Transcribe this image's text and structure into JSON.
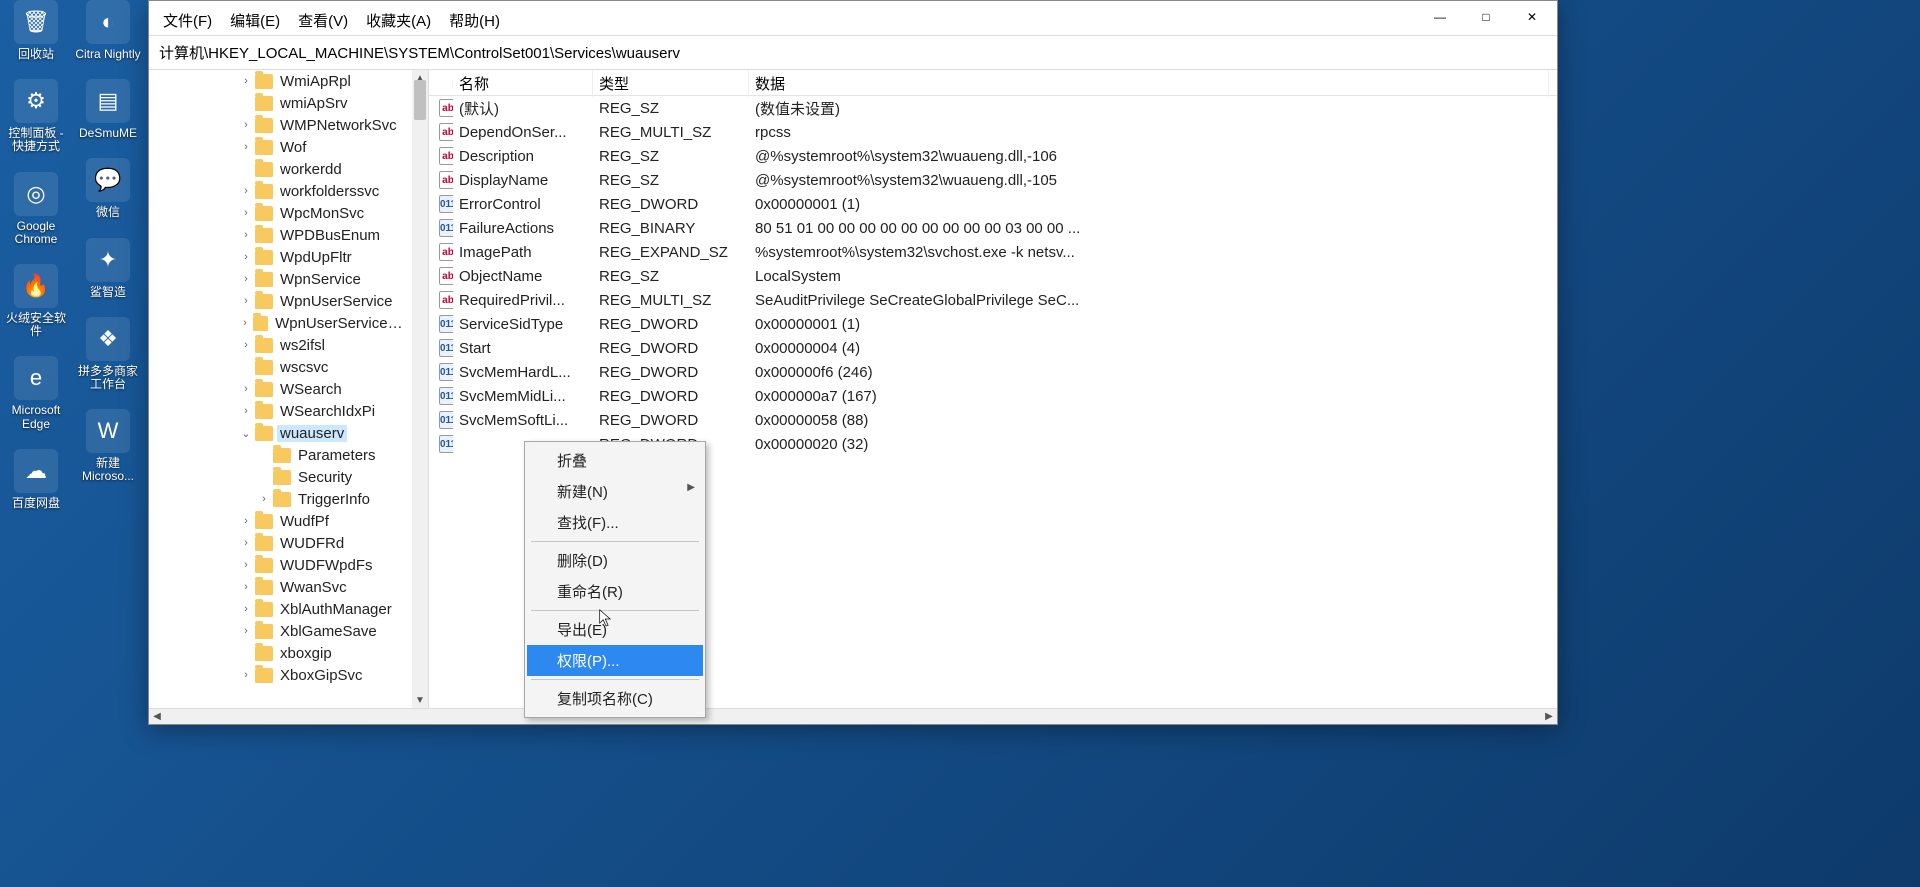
{
  "desktop_icons_col1": [
    {
      "label": "回收站",
      "glyph": "🗑"
    },
    {
      "label": "控制面板 - 快捷方式",
      "glyph": "⚙"
    },
    {
      "label": "Google Chrome",
      "glyph": "◎"
    },
    {
      "label": "火绒安全软件",
      "glyph": "🔥"
    },
    {
      "label": "Microsoft Edge",
      "glyph": "e"
    },
    {
      "label": "百度网盘",
      "glyph": "☁"
    }
  ],
  "desktop_icons_col2": [
    {
      "label": "Citra Nightly",
      "glyph": "◐"
    },
    {
      "label": "DeSmuME",
      "glyph": "▤"
    },
    {
      "label": "微信",
      "glyph": "💬"
    },
    {
      "label": "鲨智造",
      "glyph": "✦"
    },
    {
      "label": "拼多多商家工作台",
      "glyph": "❖"
    },
    {
      "label": "新建 Microso...",
      "glyph": "W"
    }
  ],
  "window": {
    "minimize": "—",
    "maximize": "□",
    "close": "✕",
    "menus": [
      "文件(F)",
      "编辑(E)",
      "查看(V)",
      "收藏夹(A)",
      "帮助(H)"
    ],
    "address": "计算机\\HKEY_LOCAL_MACHINE\\SYSTEM\\ControlSet001\\Services\\wuauserv"
  },
  "tree": [
    {
      "exp": ">",
      "label": "WmiApRpl",
      "ind": 1
    },
    {
      "exp": "",
      "label": "wmiApSrv",
      "ind": 1
    },
    {
      "exp": ">",
      "label": "WMPNetworkSvc",
      "ind": 1
    },
    {
      "exp": ">",
      "label": "Wof",
      "ind": 1
    },
    {
      "exp": "",
      "label": "workerdd",
      "ind": 1
    },
    {
      "exp": ">",
      "label": "workfolderssvc",
      "ind": 1
    },
    {
      "exp": ">",
      "label": "WpcMonSvc",
      "ind": 1
    },
    {
      "exp": ">",
      "label": "WPDBusEnum",
      "ind": 1
    },
    {
      "exp": ">",
      "label": "WpdUpFltr",
      "ind": 1
    },
    {
      "exp": ">",
      "label": "WpnService",
      "ind": 1
    },
    {
      "exp": ">",
      "label": "WpnUserService",
      "ind": 1
    },
    {
      "exp": ">",
      "label": "WpnUserService_xxxxx",
      "ind": 1
    },
    {
      "exp": ">",
      "label": "ws2ifsl",
      "ind": 1
    },
    {
      "exp": "",
      "label": "wscsvc",
      "ind": 1
    },
    {
      "exp": ">",
      "label": "WSearch",
      "ind": 1
    },
    {
      "exp": ">",
      "label": "WSearchIdxPi",
      "ind": 1
    },
    {
      "exp": "v",
      "label": "wuauserv",
      "ind": 1,
      "sel": true
    },
    {
      "exp": "",
      "label": "Parameters",
      "ind": 2
    },
    {
      "exp": "",
      "label": "Security",
      "ind": 2
    },
    {
      "exp": ">",
      "label": "TriggerInfo",
      "ind": 2
    },
    {
      "exp": ">",
      "label": "WudfPf",
      "ind": 1
    },
    {
      "exp": ">",
      "label": "WUDFRd",
      "ind": 1
    },
    {
      "exp": ">",
      "label": "WUDFWpdFs",
      "ind": 1
    },
    {
      "exp": ">",
      "label": "WwanSvc",
      "ind": 1
    },
    {
      "exp": ">",
      "label": "XblAuthManager",
      "ind": 1
    },
    {
      "exp": ">",
      "label": "XblGameSave",
      "ind": 1
    },
    {
      "exp": "",
      "label": "xboxgip",
      "ind": 1
    },
    {
      "exp": ">",
      "label": "XboxGipSvc",
      "ind": 1
    }
  ],
  "list_header": {
    "c0": "",
    "c1": "名称",
    "c2": "类型",
    "c3": "数据"
  },
  "values": [
    {
      "ic": "ab",
      "name": "(默认)",
      "type": "REG_SZ",
      "data": "(数值未设置)"
    },
    {
      "ic": "ab",
      "name": "DependOnSer...",
      "type": "REG_MULTI_SZ",
      "data": "rpcss"
    },
    {
      "ic": "ab",
      "name": "Description",
      "type": "REG_SZ",
      "data": "@%systemroot%\\system32\\wuaueng.dll,-106"
    },
    {
      "ic": "ab",
      "name": "DisplayName",
      "type": "REG_SZ",
      "data": "@%systemroot%\\system32\\wuaueng.dll,-105"
    },
    {
      "ic": "bin",
      "name": "ErrorControl",
      "type": "REG_DWORD",
      "data": "0x00000001 (1)"
    },
    {
      "ic": "bin",
      "name": "FailureActions",
      "type": "REG_BINARY",
      "data": "80 51 01 00 00 00 00 00 00 00 00 00 03 00 00 ..."
    },
    {
      "ic": "ab",
      "name": "ImagePath",
      "type": "REG_EXPAND_SZ",
      "data": "%systemroot%\\system32\\svchost.exe -k netsv..."
    },
    {
      "ic": "ab",
      "name": "ObjectName",
      "type": "REG_SZ",
      "data": "LocalSystem"
    },
    {
      "ic": "ab",
      "name": "RequiredPrivil...",
      "type": "REG_MULTI_SZ",
      "data": "SeAuditPrivilege SeCreateGlobalPrivilege SeC..."
    },
    {
      "ic": "bin",
      "name": "ServiceSidType",
      "type": "REG_DWORD",
      "data": "0x00000001 (1)"
    },
    {
      "ic": "bin",
      "name": "Start",
      "type": "REG_DWORD",
      "data": "0x00000004 (4)"
    },
    {
      "ic": "bin",
      "name": "SvcMemHardL...",
      "type": "REG_DWORD",
      "data": "0x000000f6 (246)"
    },
    {
      "ic": "bin",
      "name": "SvcMemMidLi...",
      "type": "REG_DWORD",
      "data": "0x000000a7 (167)"
    },
    {
      "ic": "bin",
      "name": "SvcMemSoftLi...",
      "type": "REG_DWORD",
      "data": "0x00000058 (88)"
    },
    {
      "ic": "bin",
      "name": "",
      "type": "REG_DWORD",
      "data": "0x00000020 (32)"
    }
  ],
  "ctx": [
    {
      "label": "折叠",
      "type": "item"
    },
    {
      "label": "新建(N)",
      "type": "sub"
    },
    {
      "label": "查找(F)...",
      "type": "item"
    },
    {
      "type": "sep"
    },
    {
      "label": "删除(D)",
      "type": "item"
    },
    {
      "label": "重命名(R)",
      "type": "item"
    },
    {
      "type": "sep"
    },
    {
      "label": "导出(E)",
      "type": "item"
    },
    {
      "label": "权限(P)...",
      "type": "item",
      "hl": true
    },
    {
      "type": "sep"
    },
    {
      "label": "复制项名称(C)",
      "type": "item"
    }
  ]
}
